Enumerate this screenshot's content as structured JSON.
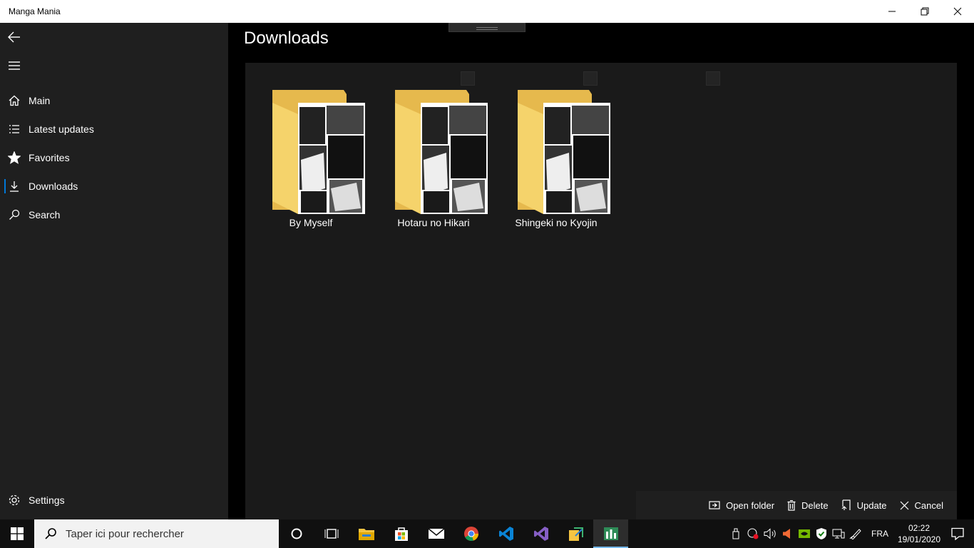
{
  "window": {
    "title": "Manga Mania"
  },
  "sidebar": {
    "items": [
      {
        "label": "Main",
        "icon": "home-icon"
      },
      {
        "label": "Latest updates",
        "icon": "list-icon"
      },
      {
        "label": "Favorites",
        "icon": "star-icon"
      },
      {
        "label": "Downloads",
        "icon": "download-icon",
        "active": true
      },
      {
        "label": "Search",
        "icon": "search-icon"
      }
    ],
    "settings_label": "Settings"
  },
  "main": {
    "title": "Downloads",
    "folders": [
      {
        "name": "By Myself"
      },
      {
        "name": "Hotaru no Hikari"
      },
      {
        "name": "Shingeki no Kyojin"
      }
    ]
  },
  "commandbar": {
    "open_folder": "Open folder",
    "delete": "Delete",
    "update": "Update",
    "cancel": "Cancel"
  },
  "taskbar": {
    "search_placeholder": "Taper ici pour rechercher",
    "language": "FRA",
    "time": "02:22",
    "date": "19/01/2020"
  },
  "colors": {
    "accent": "#0078d7",
    "folder": "#f5d36b"
  }
}
